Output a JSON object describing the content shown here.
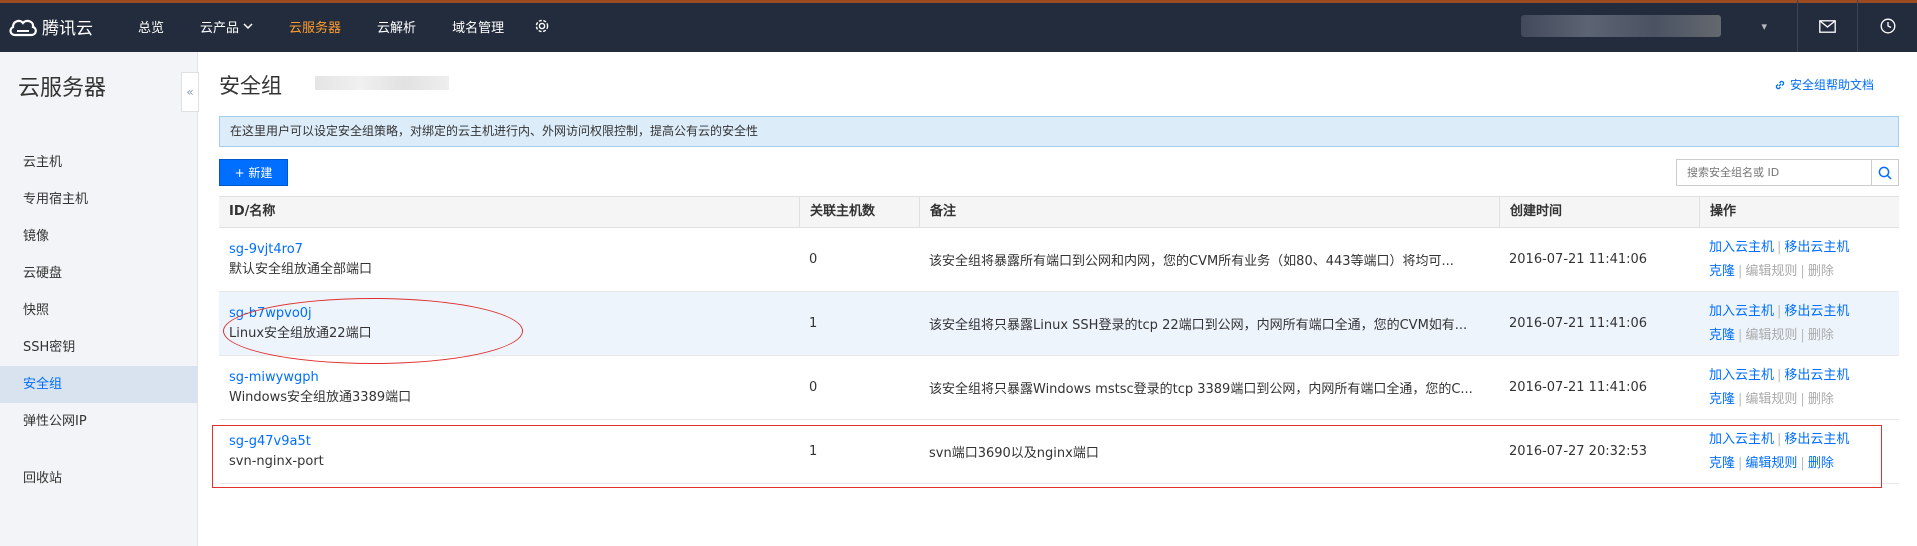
{
  "topbar": {
    "logo_text": "腾讯云",
    "nav": [
      {
        "label": "总览",
        "active": false
      },
      {
        "label": "云产品",
        "active": false,
        "has_dropdown": true
      },
      {
        "label": "云服务器",
        "active": true
      },
      {
        "label": "云解析",
        "active": false
      },
      {
        "label": "域名管理",
        "active": false
      }
    ],
    "icons": [
      "gear-icon",
      "mail-icon",
      "clock-icon"
    ],
    "colors": {
      "bg": "#232c3c",
      "active": "#ff9d2d",
      "accent": "#9b4a22"
    }
  },
  "sidebar": {
    "title": "云服务器",
    "items": [
      {
        "label": "云主机",
        "active": false
      },
      {
        "label": "专用宿主机",
        "active": false
      },
      {
        "label": "镜像",
        "active": false
      },
      {
        "label": "云硬盘",
        "active": false
      },
      {
        "label": "快照",
        "active": false
      },
      {
        "label": "SSH密钥",
        "active": false
      },
      {
        "label": "安全组",
        "active": true
      },
      {
        "label": "弹性公网IP",
        "active": false
      },
      {
        "label": "回收站",
        "active": false
      }
    ]
  },
  "main": {
    "title": "安全组",
    "help_link": "安全组帮助文档",
    "notice": "在这里用户可以设定安全组策略，对绑定的云主机进行内、外网访问权限控制，提高公有云的安全性",
    "new_button": "+ 新建",
    "search_placeholder": "搜索安全组名或 ID",
    "columns": [
      "ID/名称",
      "关联主机数",
      "备注",
      "创建时间",
      "操作"
    ],
    "rows": [
      {
        "id": "sg-9vjt4ro7",
        "name": "默认安全组放通全部端口",
        "hosts": "0",
        "remark": "该安全组将暴露所有端口到公网和内网，您的CVM所有业务（如80、443等端口）将均可...",
        "created": "2016-07-21 11:41:06",
        "op1": "加入云主机",
        "op2": "移出云主机",
        "op3": "克隆",
        "op4": "编辑规则",
        "op5": "删除",
        "ops_enabled": false
      },
      {
        "id": "sg-b7wpvo0j",
        "name": "Linux安全组放通22端口",
        "hosts": "1",
        "remark": "该安全组将只暴露Linux SSH登录的tcp 22端口到公网，内网所有端口全通，您的CVM如有...",
        "created": "2016-07-21 11:41:06",
        "op1": "加入云主机",
        "op2": "移出云主机",
        "op3": "克隆",
        "op4": "编辑规则",
        "op5": "删除",
        "ops_enabled": false
      },
      {
        "id": "sg-miwywgph",
        "name": "Windows安全组放通3389端口",
        "hosts": "0",
        "remark": "该安全组将只暴露Windows mstsc登录的tcp 3389端口到公网，内网所有端口全通，您的C...",
        "created": "2016-07-21 11:41:06",
        "op1": "加入云主机",
        "op2": "移出云主机",
        "op3": "克隆",
        "op4": "编辑规则",
        "op5": "删除",
        "ops_enabled": false
      },
      {
        "id": "sg-g47v9a5t",
        "name": "svn-nginx-port",
        "hosts": "1",
        "remark": "svn端口3690以及nginx端口",
        "created": "2016-07-27 20:32:53",
        "op1": "加入云主机",
        "op2": "移出云主机",
        "op3": "克隆",
        "op4": "编辑规则",
        "op5": "删除",
        "ops_enabled": true
      }
    ],
    "colors": {
      "link": "#006eff",
      "disabled": "#aaaaaa",
      "annotation": "#e03030"
    }
  }
}
